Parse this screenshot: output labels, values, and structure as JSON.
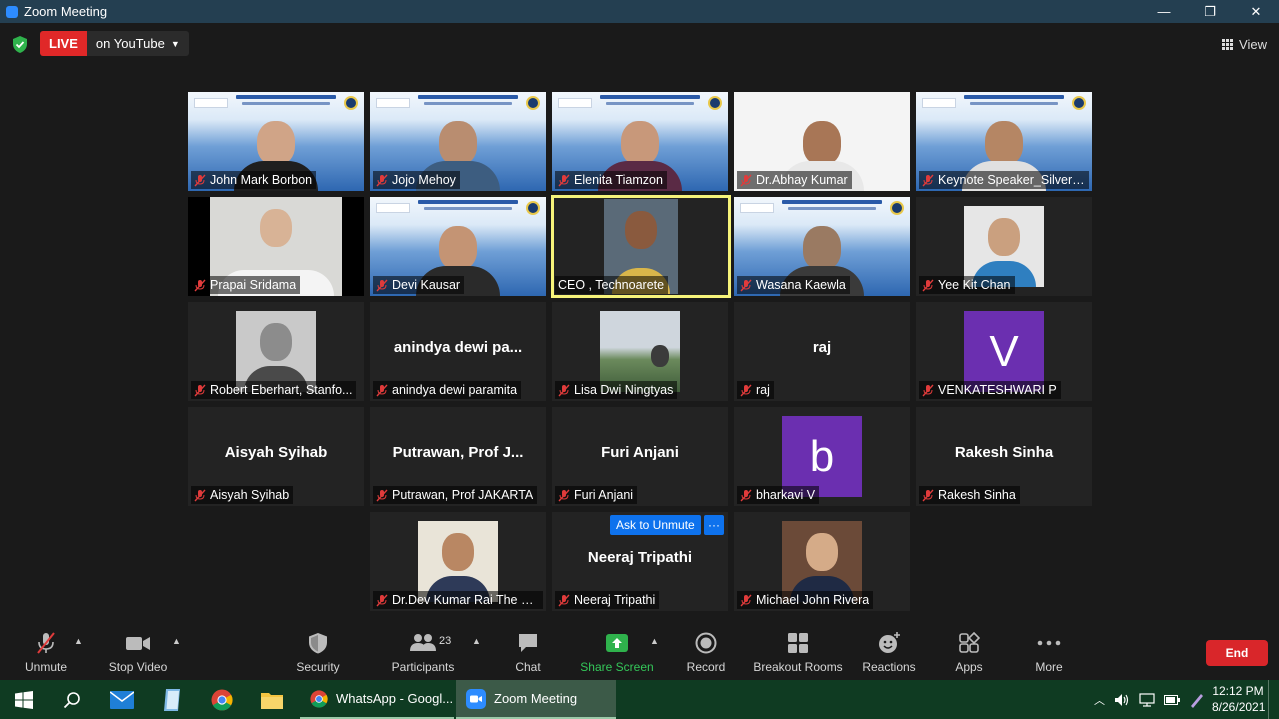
{
  "window": {
    "title": "Zoom Meeting",
    "minimize": "—",
    "maximize": "❐",
    "close": "✕"
  },
  "topbar": {
    "live_label": "LIVE",
    "live_destination": "on YouTube",
    "view_label": "View"
  },
  "tiles": [
    {
      "name": "John Mark Borbon"
    },
    {
      "name": "Jojo Mehoy"
    },
    {
      "name": "Elenita Tiamzon"
    },
    {
      "name": "Dr.Abhay Kumar"
    },
    {
      "name": "Keynote Speaker_Silveri..."
    },
    {
      "name": "Prapai Sridama"
    },
    {
      "name": "Devi Kausar"
    },
    {
      "name": "CEO , Technoarete"
    },
    {
      "name": "Wasana Kaewla"
    },
    {
      "name": "Yee Kit Chan"
    },
    {
      "name": "Robert Eberhart, Stanfo..."
    },
    {
      "name": "anindya dewi paramita",
      "display": "anindya  dewi  pa..."
    },
    {
      "name": "Lisa Dwi Ningtyas"
    },
    {
      "name": "raj",
      "display": "raj"
    },
    {
      "name": "VENKATESHWARI P",
      "letter": "V"
    },
    {
      "name": "Aisyah Syihab",
      "display": "Aisyah Syihab"
    },
    {
      "name": "Putrawan, Prof JAKARTA",
      "display": "Putrawan,  Prof  J..."
    },
    {
      "name": "Furi Anjani",
      "display": "Furi Anjani"
    },
    {
      "name": "bharkavi V",
      "letter": "b"
    },
    {
      "name": "Rakesh Sinha",
      "display": "Rakesh Sinha"
    },
    {
      "name": "Dr.Dev Kumar Rai The S..."
    },
    {
      "name": "Neeraj Tripathi",
      "display": "Neeraj Tripathi",
      "ask_unmute": "Ask to Unmute",
      "more": "···"
    },
    {
      "name": "Michael John Rivera"
    }
  ],
  "toolbar": {
    "unmute": "Unmute",
    "stop_video": "Stop Video",
    "security": "Security",
    "participants": "Participants",
    "participants_count": "23",
    "chat": "Chat",
    "share_screen": "Share Screen",
    "record": "Record",
    "breakout_rooms": "Breakout Rooms",
    "reactions": "Reactions",
    "apps": "Apps",
    "more": "More",
    "end": "End"
  },
  "taskbar": {
    "apps": [
      {
        "label": "WhatsApp - Googl..."
      },
      {
        "label": "Zoom Meeting"
      }
    ],
    "time": "12:12 PM",
    "date": "8/26/2021"
  },
  "colors": {
    "live": "#e02828",
    "accent": "#0e72ed",
    "active_speaker": "#f6f37a",
    "end": "#d9262a",
    "share": "#34c759"
  }
}
